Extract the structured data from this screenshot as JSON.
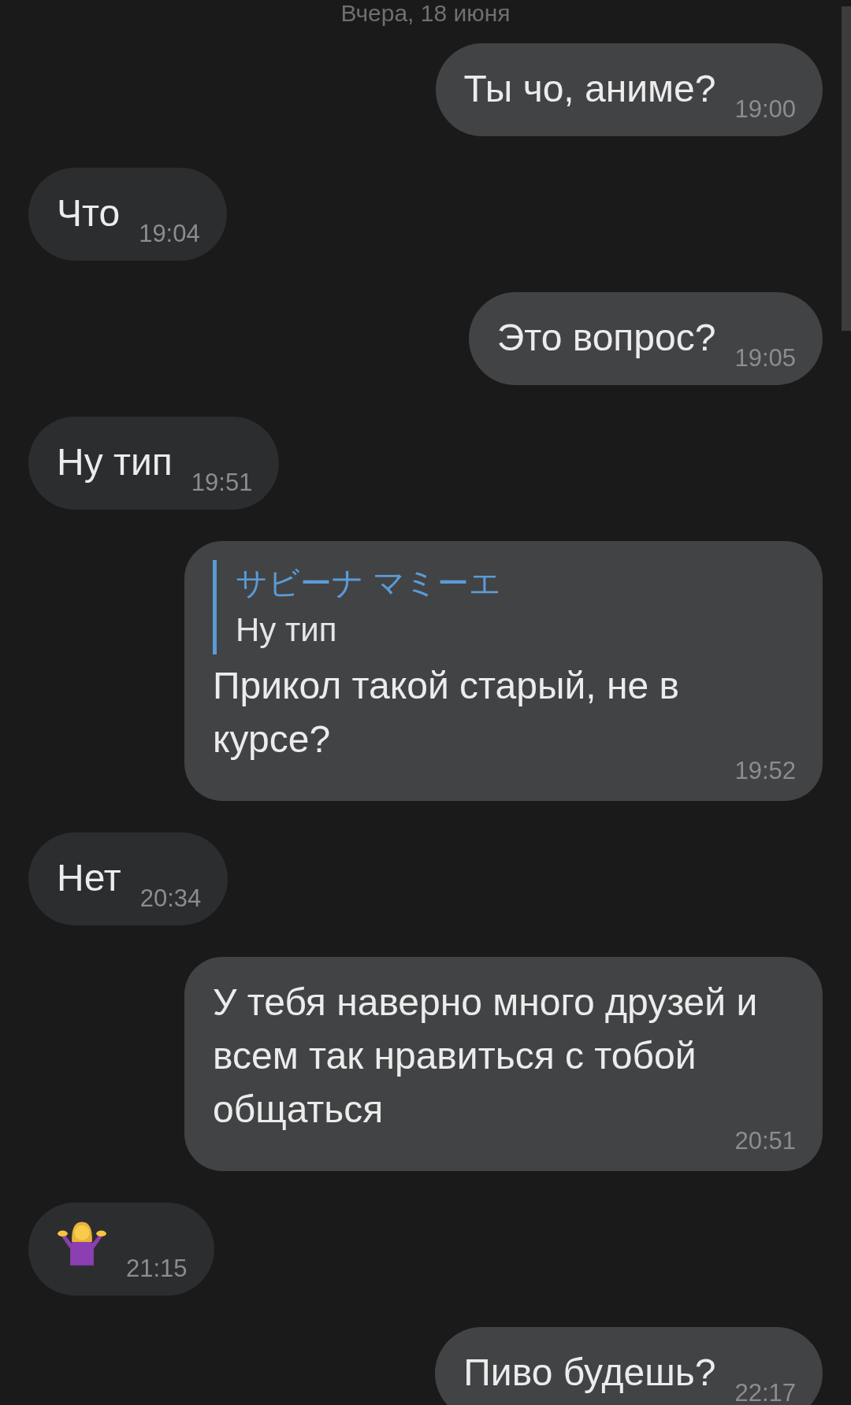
{
  "date_header": "Вчера, 18 июня",
  "messages": [
    {
      "outgoing": true,
      "kind": "text",
      "text": "Ты чо, аниме?",
      "time": "19:00"
    },
    {
      "outgoing": false,
      "kind": "text",
      "text": "Что",
      "time": "19:04"
    },
    {
      "outgoing": true,
      "kind": "text",
      "text": "Это вопрос?",
      "time": "19:05"
    },
    {
      "outgoing": false,
      "kind": "text",
      "text": "Ну тип",
      "time": "19:51"
    },
    {
      "outgoing": true,
      "kind": "reply",
      "quote_author": "サビーナ マミーエ",
      "quote_text": "Ну тип",
      "text": "Прикол такой старый, не в курсе?",
      "time": "19:52"
    },
    {
      "outgoing": false,
      "kind": "text",
      "text": "Нет",
      "time": "20:34"
    },
    {
      "outgoing": true,
      "kind": "text",
      "text": "У тебя наверно много друзей и всем так нравиться с тобой общаться",
      "time": "20:51"
    },
    {
      "outgoing": false,
      "kind": "emoji",
      "time": "21:15"
    },
    {
      "outgoing": true,
      "kind": "text",
      "text": "Пиво будешь?",
      "time": "22:17"
    }
  ]
}
